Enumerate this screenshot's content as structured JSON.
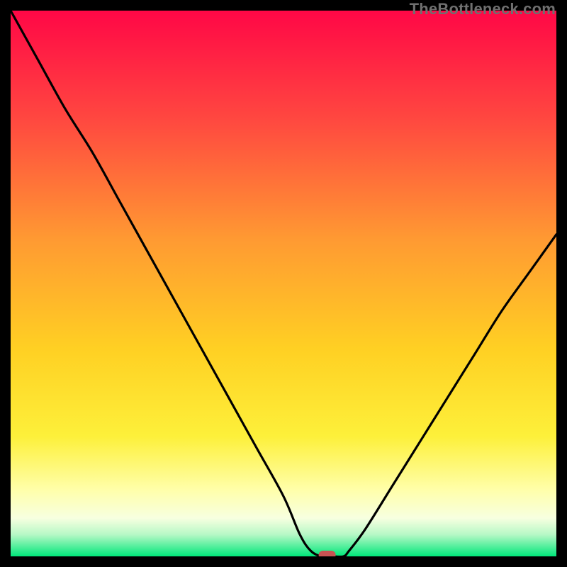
{
  "watermark": "TheBottleneck.com",
  "chart_data": {
    "type": "line",
    "title": "",
    "xlabel": "",
    "ylabel": "",
    "xlim": [
      0,
      100
    ],
    "ylim": [
      0,
      100
    ],
    "series": [
      {
        "name": "bottleneck-curve",
        "x": [
          0,
          5,
          10,
          15,
          20,
          25,
          30,
          35,
          40,
          45,
          50,
          53,
          55,
          57,
          59,
          61,
          62,
          65,
          70,
          75,
          80,
          85,
          90,
          95,
          100
        ],
        "y": [
          100,
          91,
          82,
          74,
          65,
          56,
          47,
          38,
          29,
          20,
          11,
          4,
          1,
          0,
          0,
          0,
          1,
          5,
          13,
          21,
          29,
          37,
          45,
          52,
          59
        ]
      }
    ],
    "marker": {
      "x": 58,
      "y": 0
    },
    "colors": {
      "gradient_top": "#ff0746",
      "gradient_mid_top": "#ff6d3a",
      "gradient_mid": "#ffd023",
      "gradient_light": "#ffff9b",
      "gradient_bottom": "#00e77a",
      "curve": "#000000",
      "marker": "#c95353",
      "frame": "#000000"
    }
  }
}
